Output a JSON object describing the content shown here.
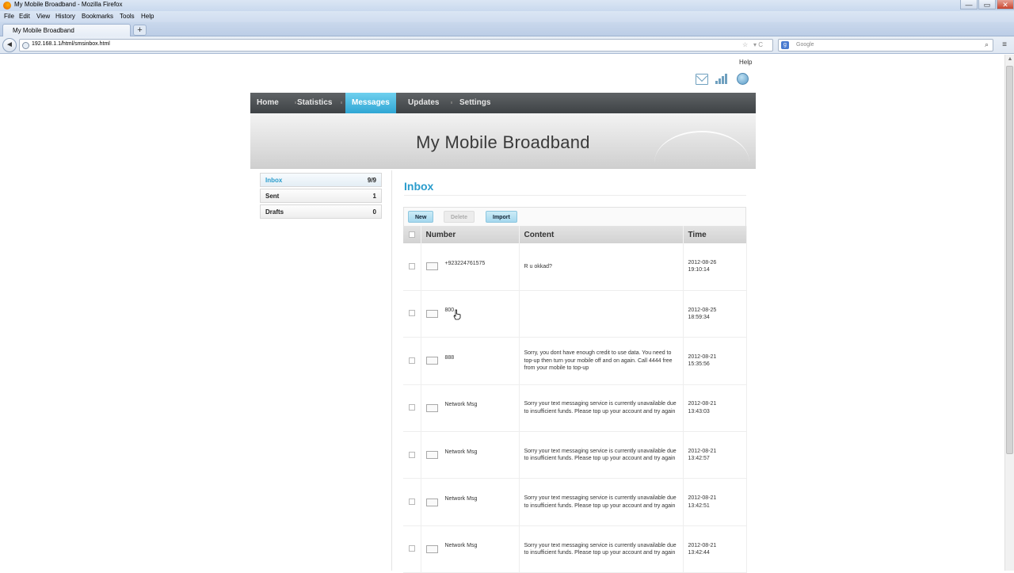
{
  "window": {
    "title": "My Mobile Broadband - Mozilla Firefox",
    "controls": {
      "minimize": "—",
      "maximize": "▭",
      "close": "✕"
    }
  },
  "menu": [
    "File",
    "Edit",
    "View",
    "History",
    "Bookmarks",
    "Tools",
    "Help"
  ],
  "tab": {
    "title": "My Mobile Broadband",
    "new_tab_label": "+"
  },
  "address": {
    "url": "192.168.1.1/html/smsinbox.html",
    "search_placeholder": "Google",
    "search_engine_letter": "g",
    "back_symbol": "◄",
    "star_symbol": "☆",
    "reload_symbol": "▾ C",
    "search_go_symbol": "⌕"
  },
  "page": {
    "help_label": "Help",
    "header_icons": [
      "envelope-icon",
      "signal-icon",
      "language-globe-icon"
    ],
    "nav": [
      {
        "label": "Home"
      },
      {
        "label": "Statistics"
      },
      {
        "label": "Messages",
        "active": true
      },
      {
        "label": "Updates"
      },
      {
        "label": "Settings"
      }
    ],
    "banner_title": "My Mobile Broadband",
    "sidebar": [
      {
        "label": "Inbox",
        "count": "9/9",
        "active": true
      },
      {
        "label": "Sent",
        "count": "1"
      },
      {
        "label": "Drafts",
        "count": "0"
      }
    ],
    "section_title": "Inbox",
    "toolbar": {
      "new_label": "New",
      "delete_label": "Delete",
      "import_label": "Import"
    },
    "table": {
      "headers": [
        "Number",
        "Content",
        "Time"
      ],
      "rows": [
        {
          "number": "+923224761575",
          "content": "R u okkad?",
          "date": "2012-08-26",
          "time": "19:10:14"
        },
        {
          "number": "800",
          "content": "",
          "date": "2012-08-25",
          "time": "18:59:34"
        },
        {
          "number": "888",
          "content": "Sorry, you dont have enough credit to use data. You need to top-up then turn your mobile off and on again. Call 4444 free from your mobile to top-up",
          "date": "2012-08-21",
          "time": "15:35:56"
        },
        {
          "number": "Network Msg",
          "content": "Sorry your text messaging service is currently unavailable due to insufficient funds. Please top up your account and try again",
          "date": "2012-08-21",
          "time": "13:43:03"
        },
        {
          "number": "Network Msg",
          "content": "Sorry your text messaging service is currently unavailable due to insufficient funds. Please top up your account and try again",
          "date": "2012-08-21",
          "time": "13:42:57"
        },
        {
          "number": "Network Msg",
          "content": "Sorry your text messaging service is currently unavailable due to insufficient funds. Please top up your account and try again",
          "date": "2012-08-21",
          "time": "13:42:51"
        },
        {
          "number": "Network Msg",
          "content": "Sorry your text messaging service is currently unavailable due to insufficient funds. Please top up your account and try again",
          "date": "2012-08-21",
          "time": "13:42:44"
        }
      ]
    }
  }
}
